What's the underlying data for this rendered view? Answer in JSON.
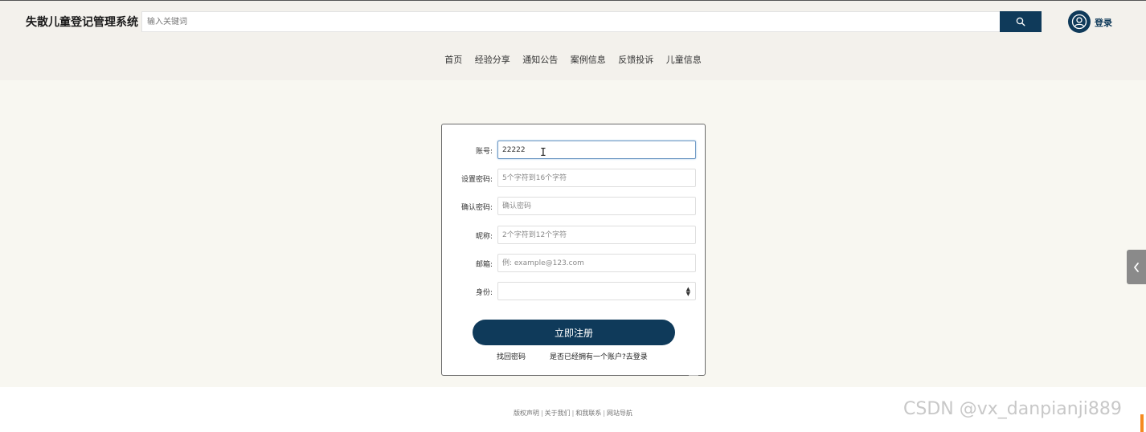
{
  "header": {
    "site_title": "失散儿童登记管理系统",
    "search_placeholder": "输入关键词",
    "login_label": "登录",
    "colors": {
      "primary": "#0f3a5a",
      "header_bg": "#f3f1ec"
    }
  },
  "nav": {
    "items": [
      "首页",
      "经验分享",
      "通知公告",
      "案例信息",
      "反馈投诉",
      "儿童信息"
    ]
  },
  "form": {
    "fields": [
      {
        "label": "账号:",
        "value": "22222",
        "placeholder": ""
      },
      {
        "label": "设置密码:",
        "value": "",
        "placeholder": "5个字符到16个字符"
      },
      {
        "label": "确认密码:",
        "value": "",
        "placeholder": "确认密码"
      },
      {
        "label": "昵称:",
        "value": "",
        "placeholder": "2个字符到12个字符"
      },
      {
        "label": "邮箱:",
        "value": "",
        "placeholder": "例: example@123.com"
      },
      {
        "label": "身份:",
        "value": "",
        "placeholder": ""
      }
    ],
    "submit_label": "立即注册",
    "forgot_label": "找回密码",
    "login_prompt": "是否已经拥有一个账户?去登录"
  },
  "footer": {
    "links": [
      "版权声明",
      "关于我们",
      "和我联系",
      "网站导航"
    ]
  },
  "watermark": "CSDN @vx_danpianji889"
}
